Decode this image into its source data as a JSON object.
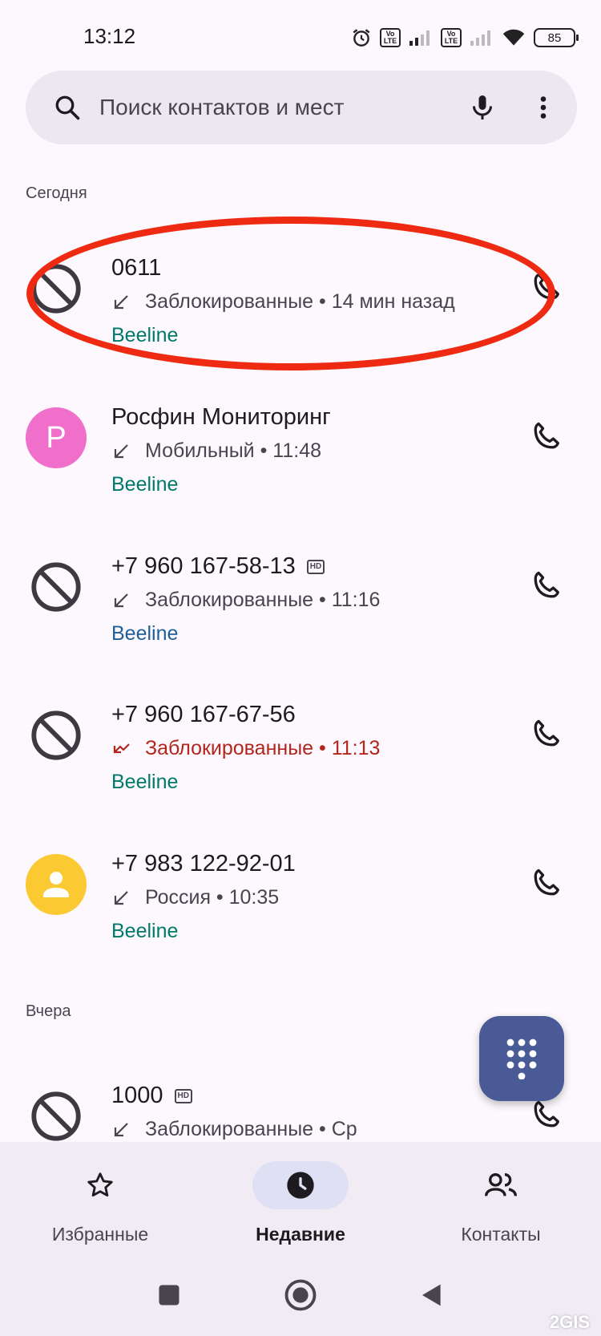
{
  "status_bar": {
    "time": "13:12",
    "sim1_label": "Vo LTE",
    "sim2_label": "Vo LTE",
    "battery": "85"
  },
  "search": {
    "placeholder": "Поиск контактов и мест",
    "icon": "search-icon",
    "mic_icon": "mic-icon",
    "more_icon": "more-vert-icon"
  },
  "sections": {
    "today": "Сегодня",
    "yesterday": "Вчера"
  },
  "calls": [
    {
      "name": "0611",
      "detail": "Заблокированные • 14 мин назад",
      "carrier": "Beeline",
      "avatar": "blocked-icon",
      "hd": false,
      "missed": false
    },
    {
      "name": "Росфин Мониторинг",
      "detail": "Мобильный • 11:48",
      "carrier": "Beeline",
      "avatar": "letter",
      "avatar_letter": "Р",
      "avatar_color": "#f06fcb",
      "hd": false,
      "missed": false
    },
    {
      "name": "+7 960 167-58-13",
      "detail": "Заблокированные • 11:16",
      "carrier": "Beeline",
      "avatar": "blocked-icon",
      "hd": true,
      "missed": false
    },
    {
      "name": "+7 960 167-67-56",
      "detail": "Заблокированные • 11:13",
      "carrier": "Beeline",
      "avatar": "blocked-icon",
      "hd": false,
      "missed": true
    },
    {
      "name": "+7 983 122-92-01",
      "detail": "Россия • 10:35",
      "carrier": "Beeline",
      "avatar": "person-icon",
      "avatar_color": "#fbc932",
      "hd": false,
      "missed": false
    },
    {
      "name": "1000",
      "detail": "Заблокированные • Ср",
      "carrier": "",
      "avatar": "blocked-icon",
      "hd": true,
      "missed": false
    }
  ],
  "hd_label": "HD",
  "fab": {
    "icon": "dialpad-icon"
  },
  "nav": {
    "favorites": "Избранные",
    "recents": "Недавние",
    "contacts": "Контакты",
    "active": "recents"
  },
  "watermark": "2GIS",
  "colors": {
    "background": "#fcf8fd",
    "accent_fab": "#4a5a96",
    "carrier_text": "#00796b",
    "missed_text": "#b3261e",
    "highlight_ellipse": "#ee2b12"
  }
}
